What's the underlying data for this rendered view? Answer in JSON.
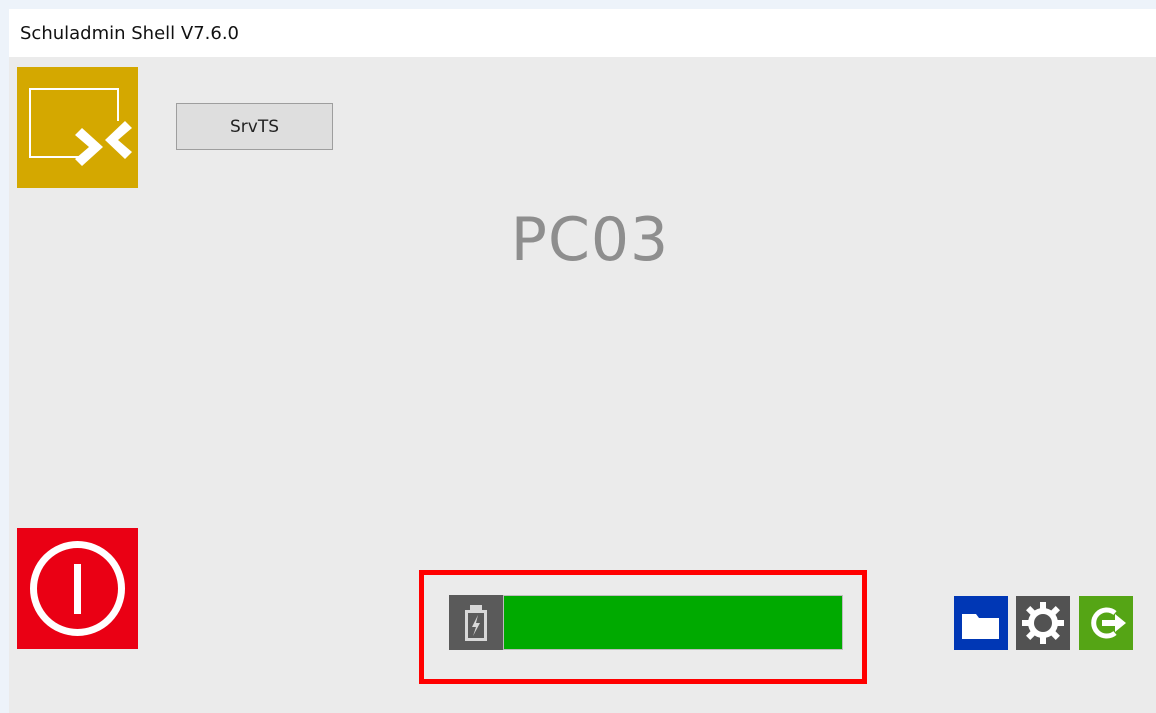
{
  "window": {
    "title": "Schuladmin Shell V7.6.0"
  },
  "remote": {
    "icon": "remote-desktop-icon",
    "button_label": "SrvTS",
    "color": "#d4a800"
  },
  "computer": {
    "name": "PC03"
  },
  "power": {
    "icon": "power-icon",
    "color": "#ea0014"
  },
  "battery": {
    "icon": "battery-charging-icon",
    "level_percent": 100,
    "fill_color": "#00aa00"
  },
  "actions": [
    {
      "icon": "folder-icon",
      "color": "#0037b5"
    },
    {
      "icon": "gear-icon",
      "color": "#525252"
    },
    {
      "icon": "logout-icon",
      "color": "#55a515"
    }
  ]
}
